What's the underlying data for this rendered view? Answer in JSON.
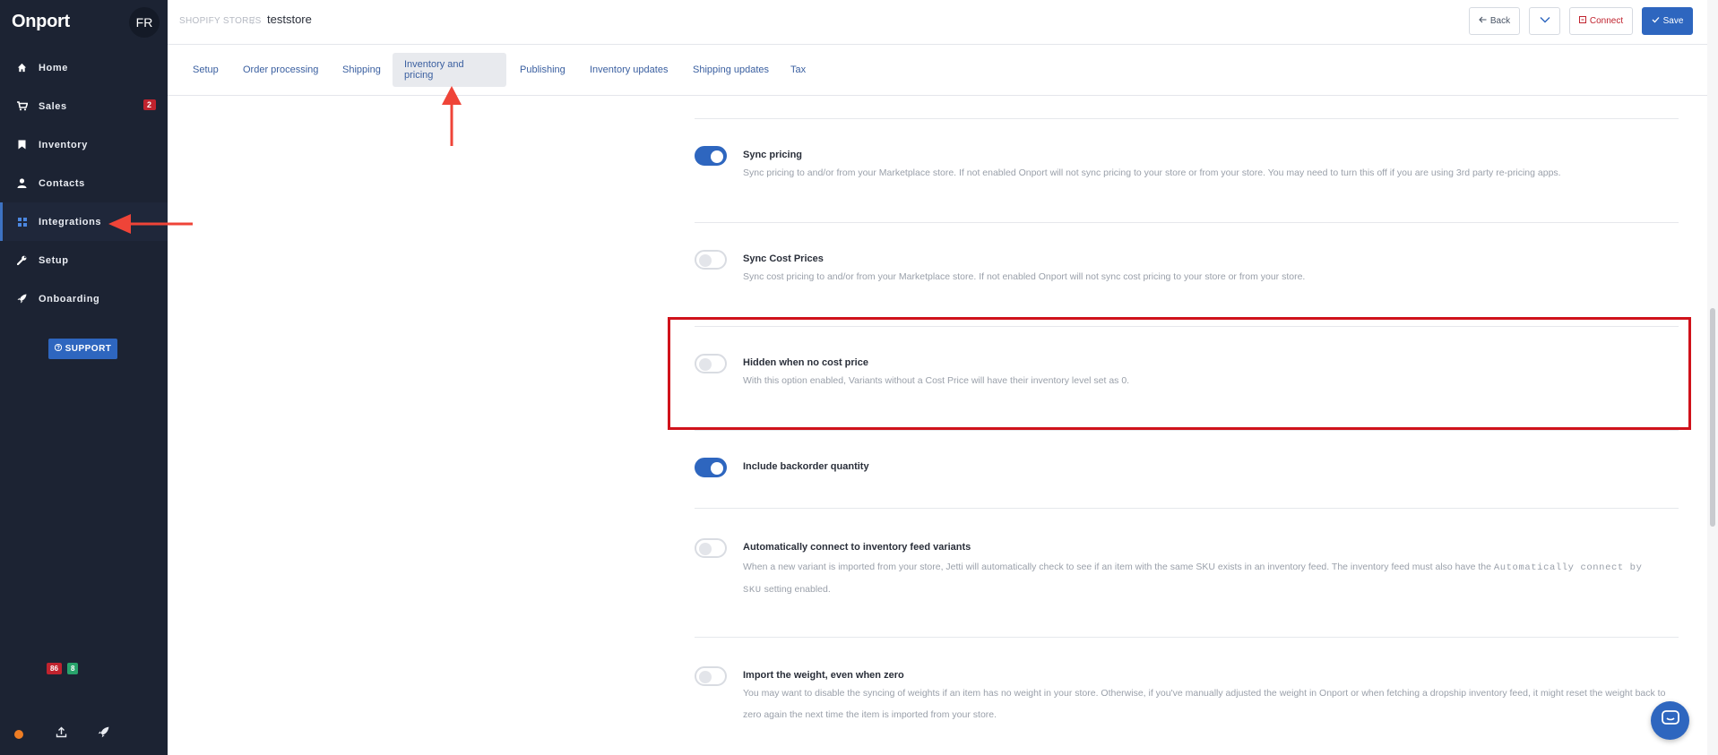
{
  "sidebar": {
    "brand": "Onport",
    "avatar_initials": "FR",
    "items": [
      {
        "label": "Home",
        "icon": "home-icon"
      },
      {
        "label": "Sales",
        "icon": "cart-icon",
        "badge": "2"
      },
      {
        "label": "Inventory",
        "icon": "bookmark-icon"
      },
      {
        "label": "Contacts",
        "icon": "person-icon"
      },
      {
        "label": "Integrations",
        "icon": "grid-icon",
        "active": true
      },
      {
        "label": "Setup",
        "icon": "wrench-icon"
      },
      {
        "label": "Onboarding",
        "icon": "rocket-icon"
      }
    ],
    "support_label": "SUPPORT",
    "bottom": {
      "red_badge": "86",
      "green_badge": "8"
    }
  },
  "header": {
    "breadcrumb_parent": "SHOPIFY STORES",
    "breadcrumb_separator": "/",
    "breadcrumb_current": "teststore",
    "back_label": "Back",
    "connect_label": "Connect",
    "save_label": "Save"
  },
  "tabs": [
    {
      "label": "Setup"
    },
    {
      "label": "Order processing"
    },
    {
      "label": "Shipping"
    },
    {
      "label": "Inventory and pricing",
      "active": true
    },
    {
      "label": "Publishing"
    },
    {
      "label": "Inventory updates"
    },
    {
      "label": "Shipping updates"
    },
    {
      "label": "Tax"
    }
  ],
  "settings": [
    {
      "title": "Sync pricing",
      "enabled": true,
      "description": "Sync pricing to and/or from your Marketplace store. If not enabled Onport will not sync pricing to your store or from your store. You may need to turn this off if you are using 3rd party re-pricing apps."
    },
    {
      "title": "Sync Cost Prices",
      "enabled": false,
      "description": "Sync cost pricing to and/or from your Marketplace store. If not enabled Onport will not sync cost pricing to your store or from your store."
    },
    {
      "title": "Hidden when no cost price",
      "enabled": false,
      "description": "With this option enabled, Variants without a Cost Price will have their inventory level set as 0."
    },
    {
      "title": "Include backorder quantity",
      "enabled": true,
      "description": ""
    },
    {
      "title": "Automatically connect to inventory feed variants",
      "enabled": false,
      "description_part1": "When a new variant is imported from your store, Jetti will automatically check to see if an item with the same SKU exists in an inventory feed. The inventory feed must also have the ",
      "description_code": "Automatically connect by SKU",
      "description_part2": " setting enabled."
    },
    {
      "title": "Import the weight, even when zero",
      "enabled": false,
      "description": "You may want to disable the syncing of weights if an item has no weight in your store. Otherwise, if you've manually adjusted the weight in Onport or when fetching a dropship inventory feed, it might reset the weight back to zero again the next time the item is imported from your store."
    }
  ],
  "colors": {
    "sidebar_bg": "#1c2333",
    "accent": "#2e66bf",
    "annotation_red": "#d0121b",
    "badge_red": "#c0232e",
    "badge_green": "#28a36b"
  }
}
